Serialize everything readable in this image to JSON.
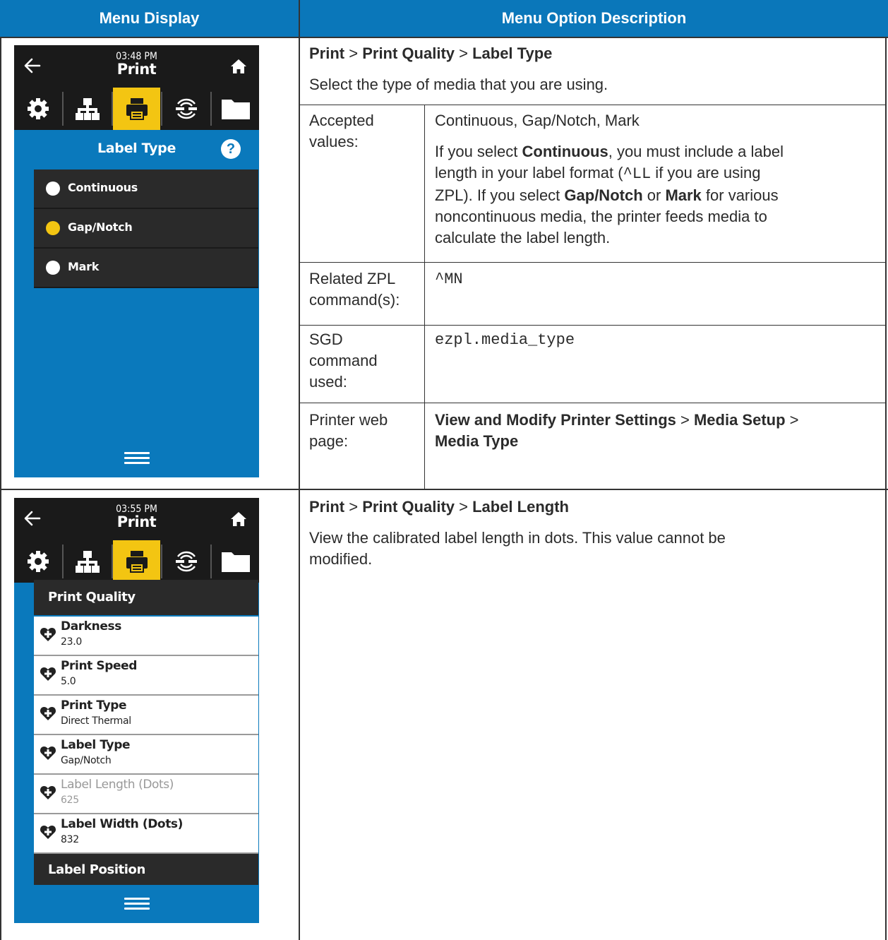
{
  "table": {
    "headers": {
      "menu_display": "Menu Display",
      "menu_option_description": "Menu Option Description"
    }
  },
  "row1": {
    "path": {
      "p1": "Print",
      "sep1": " > ",
      "p2": "Print Quality",
      "sep2": " > ",
      "p3": "Label Type"
    },
    "intro": "Select the type of media that you are using.",
    "accepted_label_1": "Accepted",
    "accepted_label_2": "values:",
    "accepted_values": "Continuous, Gap/Notch, Mark",
    "desc": {
      "t1": "If you select ",
      "b1": "Continuous",
      "t2": ", you must include a label",
      "line2a": "length in your label format (",
      "code": "^LL",
      "line2b": " if you are using",
      "t3": "ZPL). If you select ",
      "b2": "Gap/Notch",
      "t4": " or ",
      "b3": "Mark",
      "t5": " for various",
      "line4": "noncontinuous media, the printer feeds media to",
      "line5": "calculate the label length."
    },
    "zpl_label_1": "Related ZPL",
    "zpl_label_2": "command(s):",
    "zpl_value": "^MN",
    "sgd_label_1": "SGD",
    "sgd_label_2": "command",
    "sgd_label_3": "used:",
    "sgd_value": "ezpl.media_type",
    "web_label_1": "Printer web",
    "web_label_2": "page:",
    "web": {
      "b1": "View and Modify Printer Settings",
      "sep1": " > ",
      "b2": "Media Setup",
      "sep2": " >",
      "b3": "Media Type"
    },
    "screen": {
      "time": "03:48 PM",
      "title": "Print",
      "heading": "Label Type",
      "help": "?",
      "options": [
        {
          "label": "Continuous",
          "selected": false
        },
        {
          "label": "Gap/Notch",
          "selected": true
        },
        {
          "label": "Mark",
          "selected": false
        }
      ]
    }
  },
  "row2": {
    "path": {
      "p1": "Print",
      "sep1": " > ",
      "p2": "Print Quality",
      "sep2": " > ",
      "p3": "Label Length"
    },
    "desc_line1": "View the calibrated label length in dots. This value cannot be",
    "desc_line2": "modified.",
    "screen": {
      "time": "03:55 PM",
      "title": "Print",
      "section1": "Print Quality",
      "settings": [
        {
          "name": "Darkness",
          "value": "23.0"
        },
        {
          "name": "Print Speed",
          "value": "5.0"
        },
        {
          "name": "Print Type",
          "value": "Direct Thermal"
        },
        {
          "name": "Label Type",
          "value": "Gap/Notch"
        },
        {
          "name": "Label Length (Dots)",
          "value": "625"
        },
        {
          "name": "Label Width (Dots)",
          "value": "832"
        }
      ],
      "section2": "Label Position"
    }
  },
  "colors": {
    "header_blue": "#0a77ba",
    "screen_blue": "#0a79bc",
    "accent_yellow": "#f3c512",
    "dark": "#1a1a1a"
  }
}
